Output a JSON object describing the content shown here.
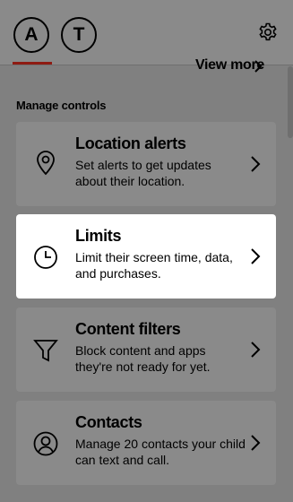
{
  "header": {
    "avatars": [
      {
        "initial": "A",
        "selected": true
      },
      {
        "initial": "T",
        "selected": false
      }
    ],
    "settings_icon": "gear-icon"
  },
  "view_more": "View more",
  "section_title": "Manage controls",
  "cards": [
    {
      "title": "Location alerts",
      "description": "Set alerts to get updates about their location.",
      "icon": "location-pin-icon",
      "active": false
    },
    {
      "title": "Limits",
      "description": "Limit their screen time, data, and purchases.",
      "icon": "clock-icon",
      "active": true
    },
    {
      "title": "Content filters",
      "description": "Block content and apps they're not ready for yet.",
      "icon": "filter-icon",
      "active": false
    },
    {
      "title": "Contacts",
      "description": "Manage 20 contacts your child can text and call.",
      "icon": "person-icon",
      "active": false
    }
  ],
  "colors": {
    "overlay": "#808080",
    "active_card": "#ffffff",
    "accent_underline": "#8e1b12"
  }
}
